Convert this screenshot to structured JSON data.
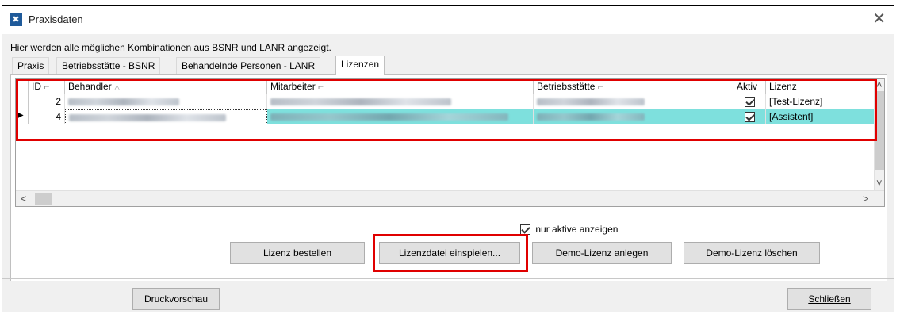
{
  "window": {
    "title": "Praxisdaten",
    "close_glyph": "✕",
    "icon_glyph": "✖"
  },
  "info_text": "Hier werden alle möglichen Kombinationen aus BSNR und LANR angezeigt.",
  "tabs": [
    {
      "label": "Praxis",
      "active": false
    },
    {
      "label": "Betriebsstätte - BSNR",
      "active": false
    },
    {
      "label": "Behandelnde Personen - LANR",
      "active": false
    },
    {
      "label": "Lizenzen",
      "active": true
    }
  ],
  "grid": {
    "columns": [
      "ID",
      "Behandler",
      "Mitarbeiter",
      "Betriebsstätte",
      "Aktiv",
      "Lizenz"
    ],
    "sort_markers": {
      "ID": "⌐",
      "Behandler": "△",
      "Mitarbeiter": "⌐",
      "Betriebsstätte": "⌐"
    },
    "rows": [
      {
        "id": "2",
        "aktiv": true,
        "lizenz": "[Test-Lizenz]",
        "selected": false
      },
      {
        "id": "4",
        "aktiv": true,
        "lizenz": "[Assistent]",
        "selected": true
      }
    ],
    "row_pointer": "▶"
  },
  "scroll": {
    "up": "˄",
    "down": "˅",
    "left": "<",
    "right": ">"
  },
  "filter": {
    "label": "nur aktive anzeigen",
    "checked": true
  },
  "buttons": {
    "lizenz_bestellen": "Lizenz bestellen",
    "lizenzdatei_einspielen": "Lizenzdatei einspielen...",
    "demo_lizenz_anlegen": "Demo-Lizenz anlegen",
    "demo_lizenz_loeschen": "Demo-Lizenz löschen",
    "druckvorschau": "Druckvorschau",
    "schliessen": "Schließen"
  },
  "highlight_color": "#e00000",
  "selection_color": "#7ee0dd"
}
